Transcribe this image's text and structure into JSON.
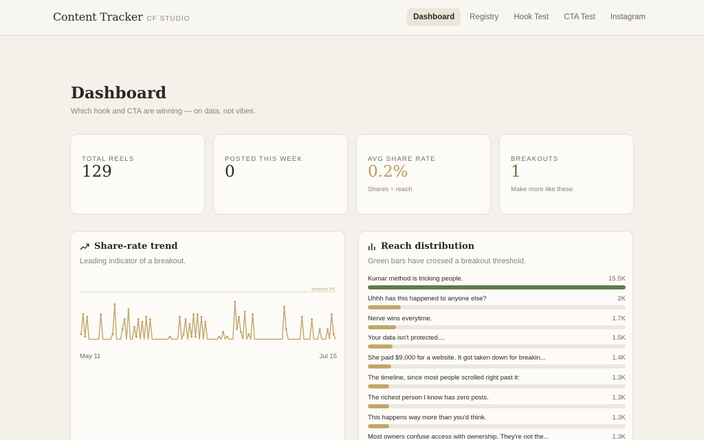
{
  "brand": {
    "name": "Content Tracker",
    "sub": "CF STUDIO"
  },
  "nav": [
    "Dashboard",
    "Registry",
    "Hook Test",
    "CTA Test",
    "Instagram"
  ],
  "nav_active": 0,
  "page": {
    "title": "Dashboard",
    "subtitle": "Which hook and CTA are winning — on data, not vibes."
  },
  "stats": [
    {
      "label": "TOTAL REELS",
      "value": "129",
      "note": ""
    },
    {
      "label": "POSTED THIS WEEK",
      "value": "0",
      "note": ""
    },
    {
      "label": "AVG SHARE RATE",
      "value": "0.2%",
      "note": "Shares ÷ reach"
    },
    {
      "label": "BREAKOUTS",
      "value": "1",
      "note": "Make more like these"
    }
  ],
  "trend": {
    "title": "Share-rate trend",
    "subtitle": "Leading indicator of a breakout.",
    "icon": "trending-up-icon",
    "start_label": "May 11",
    "end_label": "Jul 15",
    "threshold_label": "breakout 2%"
  },
  "chart_data": {
    "type": "line",
    "title": "Share-rate trend",
    "threshold": 2.0,
    "ylim": [
      0,
      2.4
    ],
    "x_range": [
      "May 11",
      "Jul 15"
    ],
    "values": [
      0.3,
      1.1,
      0.2,
      1.0,
      0.1,
      0.1,
      0.1,
      0.1,
      0.1,
      0.1,
      1.1,
      0.1,
      0.1,
      0.1,
      0.1,
      0.1,
      0.3,
      1.5,
      0.1,
      0.1,
      0.1,
      0.5,
      0.9,
      0.1,
      1.3,
      0.1,
      0.1,
      0.6,
      0.2,
      0.9,
      0.1,
      0.8,
      0.1,
      1.0,
      0.1,
      0.9,
      0.1,
      0.1,
      0.1,
      0.1,
      0.1,
      0.1,
      0.1,
      0.1,
      0.1,
      0.2,
      0.1,
      0.1,
      0.1,
      0.1,
      1.0,
      0.1,
      0.3,
      0.9,
      0.1,
      0.7,
      0.2,
      1.1,
      0.2,
      1.1,
      0.1,
      1.0,
      0.1,
      0.8,
      0.1,
      0.1,
      0.1,
      0.1,
      0.1,
      0.1,
      0.2,
      0.1,
      0.4,
      0.1,
      0.2,
      0.1,
      0.1,
      0.1,
      1.6,
      0.5,
      1.0,
      0.4,
      0.1,
      1.2,
      0.1,
      0.3,
      0.1,
      1.1,
      0.1,
      0.1,
      0.1,
      0.1,
      0.1,
      0.1,
      0.1,
      0.1,
      0.1,
      0.1,
      0.1,
      0.1,
      0.1,
      0.1,
      0.1,
      1.4,
      0.5,
      0.1,
      0.1,
      0.1,
      0.1,
      0.1,
      0.1,
      0.1,
      1.0,
      0.1,
      0.1,
      0.1,
      0.1,
      0.9,
      0.1,
      0.1,
      0.1,
      0.5,
      0.1,
      0.1,
      0.1,
      0.5,
      0.1,
      1.1,
      0.3,
      0.1
    ]
  },
  "dist": {
    "title": "Reach distribution",
    "subtitle": "Green bars have crossed a breakout threshold.",
    "icon": "bar-chart-icon",
    "max": 15500,
    "items": [
      {
        "label": "Kumar method is tricking people.",
        "value": "15.5K",
        "n": 15500,
        "breakout": true
      },
      {
        "label": "Uhhh has this happened to anyone else?",
        "value": "2K",
        "n": 2000,
        "breakout": false
      },
      {
        "label": "Nerve wins everytime.",
        "value": "1.7K",
        "n": 1700,
        "breakout": false
      },
      {
        "label": "Your data isn't protected....",
        "value": "1.5K",
        "n": 1500,
        "breakout": false
      },
      {
        "label": "She paid $9,000 for a website. It got taken down for breakin...",
        "value": "1.4K",
        "n": 1400,
        "breakout": false
      },
      {
        "label": "The timeline, since most people scrolled right past it:",
        "value": "1.3K",
        "n": 1300,
        "breakout": false
      },
      {
        "label": "The richest person I know has zero posts.",
        "value": "1.3K",
        "n": 1300,
        "breakout": false
      },
      {
        "label": "This happens way more than you'd think.",
        "value": "1.3K",
        "n": 1300,
        "breakout": false
      },
      {
        "label": "Most owners confuse access with ownership. They're not the...",
        "value": "1.3K",
        "n": 1300,
        "breakout": false
      }
    ]
  },
  "colors": {
    "accent_gold": "#c2a66c",
    "breakout_green": "#5f7a4c",
    "background": "#f3f1ea"
  }
}
